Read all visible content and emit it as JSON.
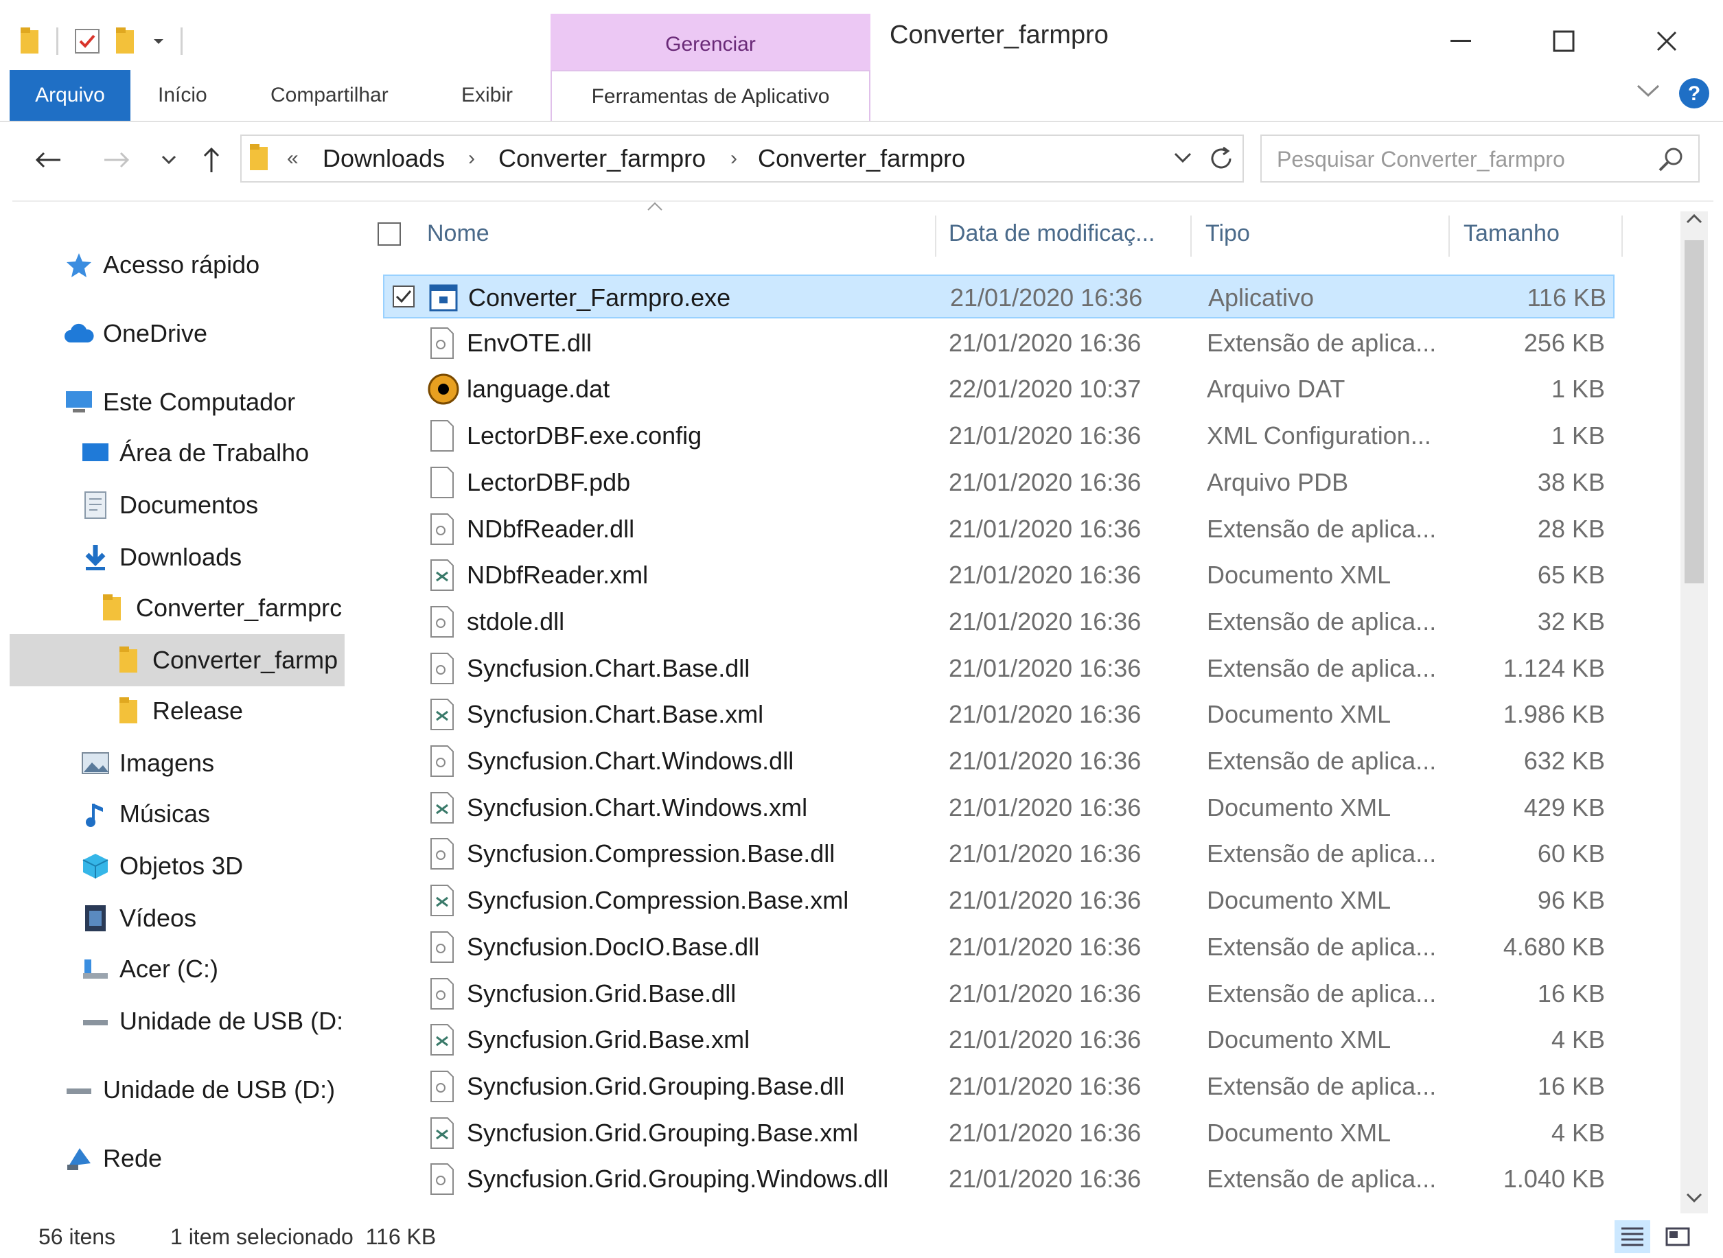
{
  "window": {
    "title": "Converter_farmpro",
    "manage_tab": "Gerenciar"
  },
  "ribbon": {
    "tabs": [
      {
        "label": "Arquivo"
      },
      {
        "label": "Início"
      },
      {
        "label": "Compartilhar"
      },
      {
        "label": "Exibir"
      },
      {
        "label": "Ferramentas de Aplicativo"
      }
    ]
  },
  "address": {
    "crumbs": [
      "Downloads",
      "Converter_farmpro",
      "Converter_farmpro"
    ],
    "search_placeholder": "Pesquisar Converter_farmpro"
  },
  "nav": {
    "items": [
      {
        "label": "Acesso rápido",
        "icon": "star-icon"
      },
      {
        "label": "OneDrive",
        "icon": "cloud-icon"
      },
      {
        "label": "Este Computador",
        "icon": "computer-icon"
      },
      {
        "label": "Área de Trabalho",
        "icon": "desktop-icon"
      },
      {
        "label": "Documentos",
        "icon": "documents-icon"
      },
      {
        "label": "Downloads",
        "icon": "download-icon"
      },
      {
        "label": "Converter_farmprc",
        "icon": "folder-icon"
      },
      {
        "label": "Converter_farmp",
        "icon": "folder-icon"
      },
      {
        "label": "Release",
        "icon": "folder-icon"
      },
      {
        "label": "Imagens",
        "icon": "pictures-icon"
      },
      {
        "label": "Músicas",
        "icon": "music-icon"
      },
      {
        "label": "Objetos 3D",
        "icon": "objects-3d-icon"
      },
      {
        "label": "Vídeos",
        "icon": "videos-icon"
      },
      {
        "label": "Acer (C:)",
        "icon": "drive-icon"
      },
      {
        "label": "Unidade de USB (D:",
        "icon": "usb-drive-icon"
      },
      {
        "label": "Unidade de USB (D:)",
        "icon": "usb-drive-icon"
      },
      {
        "label": "Rede",
        "icon": "network-icon"
      }
    ]
  },
  "columns": {
    "name": "Nome",
    "date": "Data de modificaç...",
    "type": "Tipo",
    "size": "Tamanho"
  },
  "files": [
    {
      "name": "Converter_Farmpro.exe",
      "date": "21/01/2020 16:36",
      "type": "Aplicativo",
      "size": "116 KB",
      "icon": "exe-icon"
    },
    {
      "name": "EnvOTE.dll",
      "date": "21/01/2020 16:36",
      "type": "Extensão de aplica...",
      "size": "256 KB",
      "icon": "dll-icon"
    },
    {
      "name": "language.dat",
      "date": "22/01/2020 10:37",
      "type": "Arquivo DAT",
      "size": "1 KB",
      "icon": "dat-icon"
    },
    {
      "name": "LectorDBF.exe.config",
      "date": "21/01/2020 16:36",
      "type": "XML Configuration...",
      "size": "1 KB",
      "icon": "blank-file-icon"
    },
    {
      "name": "LectorDBF.pdb",
      "date": "21/01/2020 16:36",
      "type": "Arquivo PDB",
      "size": "38 KB",
      "icon": "blank-file-icon"
    },
    {
      "name": "NDbfReader.dll",
      "date": "21/01/2020 16:36",
      "type": "Extensão de aplica...",
      "size": "28 KB",
      "icon": "dll-icon"
    },
    {
      "name": "NDbfReader.xml",
      "date": "21/01/2020 16:36",
      "type": "Documento XML",
      "size": "65 KB",
      "icon": "xml-icon"
    },
    {
      "name": "stdole.dll",
      "date": "21/01/2020 16:36",
      "type": "Extensão de aplica...",
      "size": "32 KB",
      "icon": "dll-icon"
    },
    {
      "name": "Syncfusion.Chart.Base.dll",
      "date": "21/01/2020 16:36",
      "type": "Extensão de aplica...",
      "size": "1.124 KB",
      "icon": "dll-icon"
    },
    {
      "name": "Syncfusion.Chart.Base.xml",
      "date": "21/01/2020 16:36",
      "type": "Documento XML",
      "size": "1.986 KB",
      "icon": "xml-icon"
    },
    {
      "name": "Syncfusion.Chart.Windows.dll",
      "date": "21/01/2020 16:36",
      "type": "Extensão de aplica...",
      "size": "632 KB",
      "icon": "dll-icon"
    },
    {
      "name": "Syncfusion.Chart.Windows.xml",
      "date": "21/01/2020 16:36",
      "type": "Documento XML",
      "size": "429 KB",
      "icon": "xml-icon"
    },
    {
      "name": "Syncfusion.Compression.Base.dll",
      "date": "21/01/2020 16:36",
      "type": "Extensão de aplica...",
      "size": "60 KB",
      "icon": "dll-icon"
    },
    {
      "name": "Syncfusion.Compression.Base.xml",
      "date": "21/01/2020 16:36",
      "type": "Documento XML",
      "size": "96 KB",
      "icon": "xml-icon"
    },
    {
      "name": "Syncfusion.DocIO.Base.dll",
      "date": "21/01/2020 16:36",
      "type": "Extensão de aplica...",
      "size": "4.680 KB",
      "icon": "dll-icon"
    },
    {
      "name": "Syncfusion.Grid.Base.dll",
      "date": "21/01/2020 16:36",
      "type": "Extensão de aplica...",
      "size": "16 KB",
      "icon": "dll-icon"
    },
    {
      "name": "Syncfusion.Grid.Base.xml",
      "date": "21/01/2020 16:36",
      "type": "Documento XML",
      "size": "4 KB",
      "icon": "xml-icon"
    },
    {
      "name": "Syncfusion.Grid.Grouping.Base.dll",
      "date": "21/01/2020 16:36",
      "type": "Extensão de aplica...",
      "size": "16 KB",
      "icon": "dll-icon"
    },
    {
      "name": "Syncfusion.Grid.Grouping.Base.xml",
      "date": "21/01/2020 16:36",
      "type": "Documento XML",
      "size": "4 KB",
      "icon": "xml-icon"
    },
    {
      "name": "Syncfusion.Grid.Grouping.Windows.dll",
      "date": "21/01/2020 16:36",
      "type": "Extensão de aplica...",
      "size": "1.040 KB",
      "icon": "dll-icon"
    }
  ],
  "status": {
    "item_count": "56 itens",
    "selection": "1 item selecionado  116 KB"
  },
  "colors": {
    "accent": "#1f6fc5",
    "manage_tab": "#ecc8f4",
    "selection": "#cce8ff",
    "folder": "#f3c13a"
  }
}
